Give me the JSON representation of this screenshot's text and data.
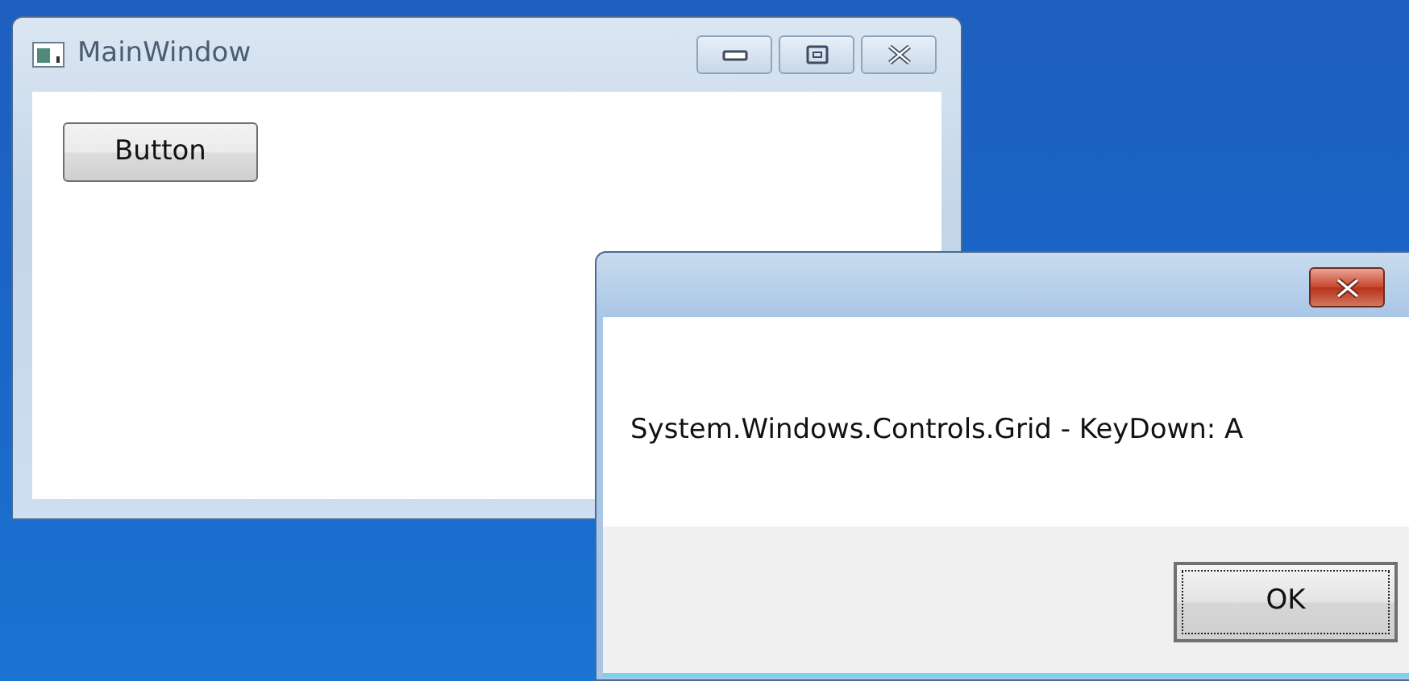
{
  "main_window": {
    "title": "MainWindow",
    "button": "Button"
  },
  "dialog": {
    "message": "System.Windows.Controls.Grid - KeyDown: A",
    "ok_button": {
      "label": "OK",
      "focused": true
    }
  }
}
